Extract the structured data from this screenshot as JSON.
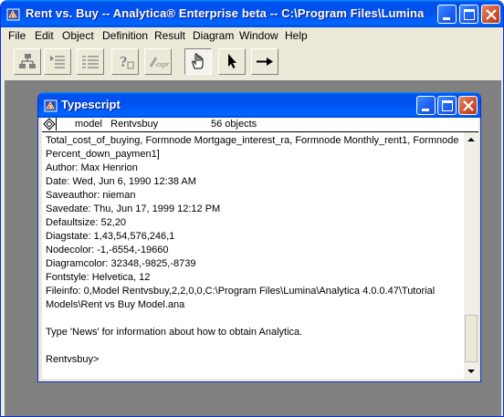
{
  "app": {
    "title": "Rent vs. Buy -- Analytica® Enterprise beta -- C:\\Program Files\\Lumina"
  },
  "menu": {
    "items": [
      "File",
      "Edit",
      "Object",
      "Definition",
      "Result",
      "Diagram",
      "Window",
      "Help"
    ]
  },
  "toolbar": {
    "icons": [
      "hierarchy-icon",
      "indent-list-icon",
      "outline-list-icon",
      "question-icon",
      "expression-icon",
      "hand-browse-icon",
      "arrow-edit-icon",
      "arrow-connect-icon"
    ],
    "pressed": "hand-browse-icon"
  },
  "typescript": {
    "title": "Typescript",
    "header": {
      "model": "model   Rentvsbuy",
      "count": "56 objects"
    },
    "lines": [
      "Total_cost_of_buying, Formnode Mortgage_interest_ra, Formnode Monthly_rent1, Formnode",
      "Percent_down_paymen1]",
      "Author: Max Henrion",
      "Date: Wed, Jun 6, 1990 12:38 AM",
      "Saveauthor: nieman",
      "Savedate: Thu, Jun 17, 1999 12:12 PM",
      "Defaultsize: 52,20",
      "Diagstate: 1,43,54,576,246,1",
      "Nodecolor: -1,-6554,-19660",
      "Diagramcolor: 32348,-9825,-8739",
      "Fontstyle: Helvetica, 12",
      "Fileinfo: 0,Model Rentvsbuy,2,2,0,0,C:\\Program Files\\Lumina\\Analytica 4.0.0.47\\Tutorial",
      "Models\\Rent vs Buy Model.ana",
      "",
      "Type 'News' for information about how to obtain Analytica.",
      "",
      "Rentvsbuy>"
    ]
  }
}
